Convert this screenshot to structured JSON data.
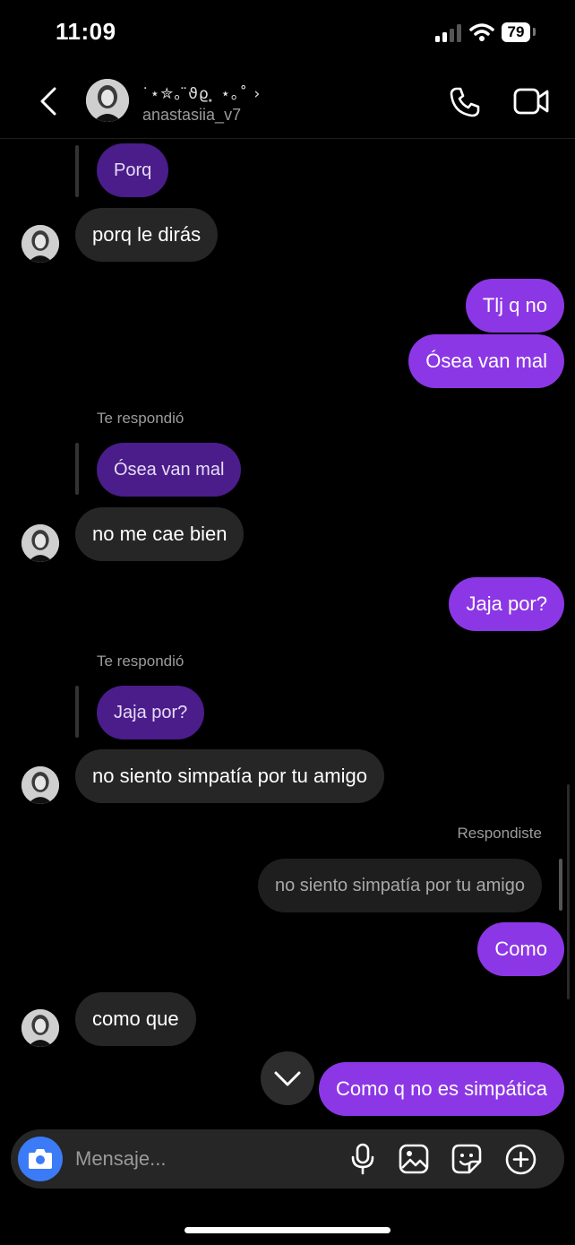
{
  "status_bar": {
    "time": "11:09",
    "battery": "79"
  },
  "header": {
    "display_name": "˙⋆✮｡ ̈ϑϱ ̟ ⋆｡˚ ›",
    "username": "anastasiia_v7"
  },
  "messages": {
    "q1": "Porq",
    "m1": "porq le dirás",
    "m2": "Tlj q no",
    "m3": "Ósea van mal",
    "label1": "Te respondió",
    "q2": "Ósea van mal",
    "m4": "no me cae bien",
    "m5": "Jaja por?",
    "label2": "Te respondió",
    "q3": "Jaja por?",
    "m6": "no siento simpatía por tu amigo",
    "label3": "Respondiste",
    "q4": "no siento simpatía por tu amigo",
    "m7": "Como",
    "m8": "como que",
    "m9": "Como q no es simpática"
  },
  "composer": {
    "placeholder": "Mensaje..."
  },
  "colors": {
    "outgoing": "#8c37e6",
    "incoming": "#262626",
    "quote": "#4a1d8a",
    "camera": "#3b7bf7"
  },
  "icons": [
    "back-icon",
    "phone-icon",
    "video-icon",
    "camera-icon",
    "microphone-icon",
    "gallery-icon",
    "sticker-icon",
    "plus-icon",
    "chevron-down-icon",
    "signal-icon",
    "wifi-icon"
  ]
}
